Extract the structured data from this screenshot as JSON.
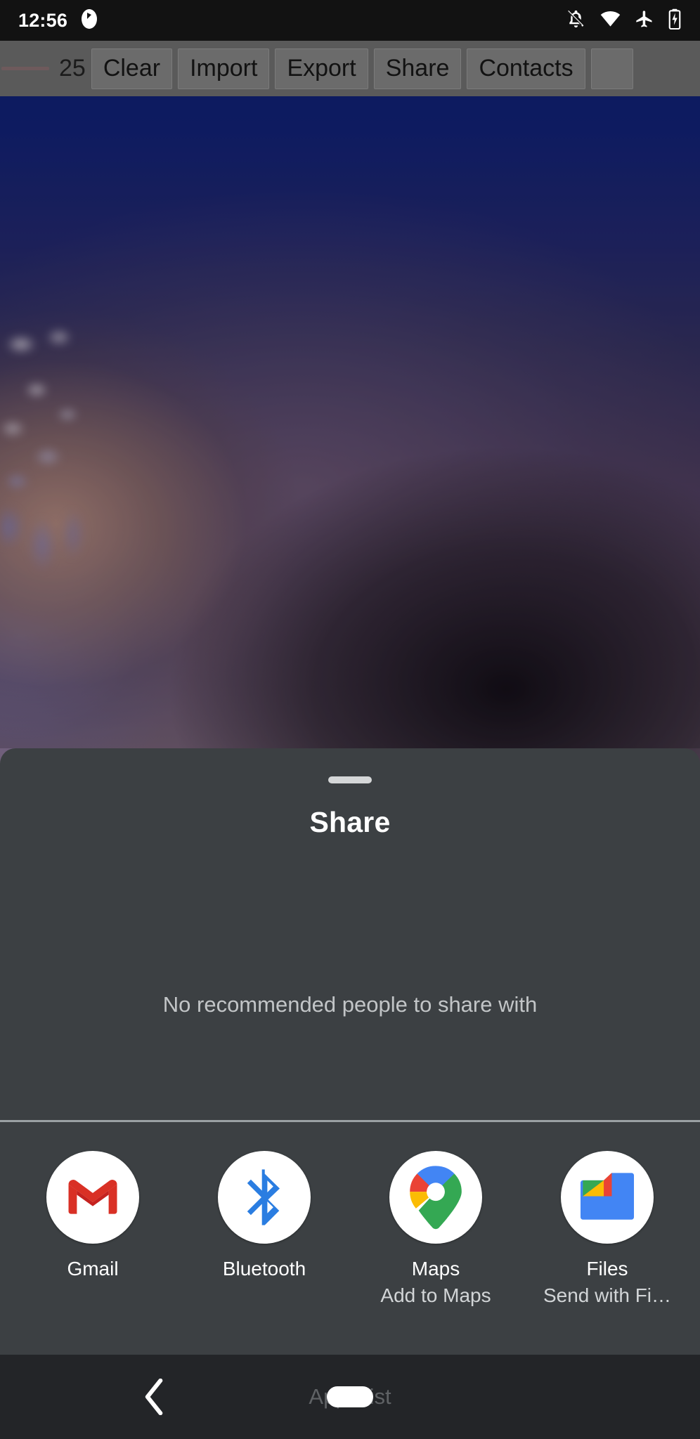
{
  "status_bar": {
    "time": "12:56",
    "icons": [
      {
        "name": "app-notification-icon",
        "glyph": "app-badge"
      },
      {
        "name": "notifications-off-icon",
        "glyph": "bell-slash"
      },
      {
        "name": "wifi-icon",
        "glyph": "wifi"
      },
      {
        "name": "airplane-mode-icon",
        "glyph": "airplane"
      },
      {
        "name": "battery-charging-icon",
        "glyph": "battery-bolt"
      }
    ]
  },
  "app_toolbar": {
    "count": "25",
    "buttons": [
      {
        "label": "Clear"
      },
      {
        "label": "Import"
      },
      {
        "label": "Export"
      },
      {
        "label": "Share"
      },
      {
        "label": "Contacts"
      },
      {
        "label": ""
      }
    ]
  },
  "share_sheet": {
    "title": "Share",
    "empty_message": "No recommended people to share with",
    "targets": [
      {
        "label": "Gmail",
        "sublabel": "",
        "icon": "gmail-icon"
      },
      {
        "label": "Bluetooth",
        "sublabel": "",
        "icon": "bluetooth-icon"
      },
      {
        "label": "Maps",
        "sublabel": "Add to Maps",
        "icon": "maps-icon"
      },
      {
        "label": "Files",
        "sublabel": "Send with Fi…",
        "icon": "files-icon"
      }
    ]
  },
  "nav_bar": {
    "apps_list_label": "Apps list"
  },
  "colors": {
    "sheet_background": "#3c4043",
    "status_bar_background": "#121212",
    "nav_bar_background": "#232528",
    "toolbar_background": "#5a5a5a",
    "divider": "#9aa0a3",
    "gmail_red": "#d93025",
    "bluetooth_blue": "#2a7de1",
    "google_blue": "#4285f4",
    "google_red": "#ea4335",
    "google_yellow": "#fbbc04",
    "google_green": "#34a853"
  }
}
